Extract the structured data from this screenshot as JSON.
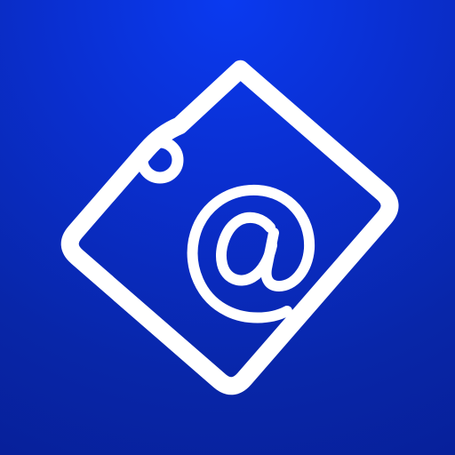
{
  "icon": {
    "name": "email-tag-icon",
    "glyph": "@",
    "colors": {
      "background": "#0a2fd0",
      "background_dark": "#07209a",
      "foreground": "#ffffff"
    }
  }
}
